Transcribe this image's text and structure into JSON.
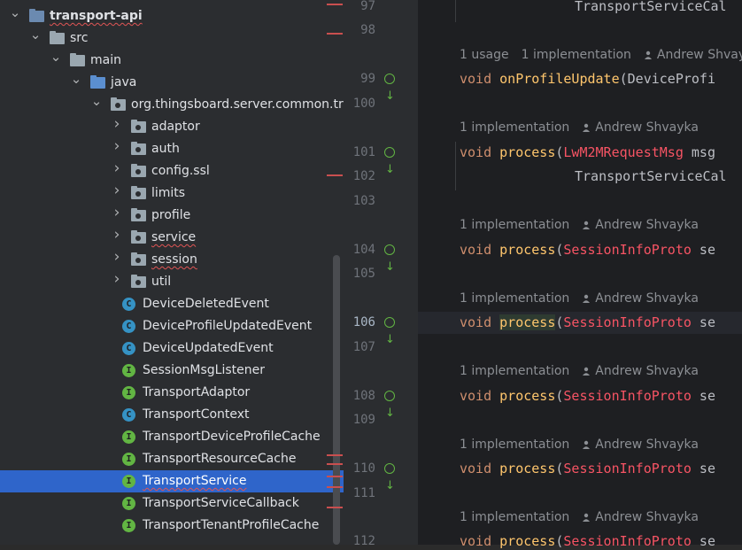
{
  "project_tree": {
    "items": [
      {
        "label": "transport-api",
        "icon": "module-folder-icon",
        "expand": "expanded",
        "squiggle": true,
        "bold": true
      },
      {
        "label": "src",
        "icon": "folder-icon",
        "expand": "expanded"
      },
      {
        "label": "main",
        "icon": "folder-icon",
        "expand": "expanded"
      },
      {
        "label": "java",
        "icon": "source-root-icon",
        "expand": "expanded"
      },
      {
        "label": "org.thingsboard.server.common.trans",
        "icon": "package-icon",
        "expand": "expanded"
      },
      {
        "label": "adaptor",
        "icon": "package-icon",
        "expand": "collapsed"
      },
      {
        "label": "auth",
        "icon": "package-icon",
        "expand": "collapsed"
      },
      {
        "label": "config.ssl",
        "icon": "package-icon",
        "expand": "collapsed"
      },
      {
        "label": "limits",
        "icon": "package-icon",
        "expand": "collapsed"
      },
      {
        "label": "profile",
        "icon": "package-icon",
        "expand": "collapsed"
      },
      {
        "label": "service",
        "icon": "package-icon",
        "expand": "collapsed",
        "squiggle": true
      },
      {
        "label": "session",
        "icon": "package-icon",
        "expand": "collapsed",
        "squiggle": true
      },
      {
        "label": "util",
        "icon": "package-icon",
        "expand": "collapsed"
      },
      {
        "label": "DeviceDeletedEvent",
        "icon": "class-icon",
        "kind": "C"
      },
      {
        "label": "DeviceProfileUpdatedEvent",
        "icon": "class-icon",
        "kind": "C"
      },
      {
        "label": "DeviceUpdatedEvent",
        "icon": "class-icon",
        "kind": "C"
      },
      {
        "label": "SessionMsgListener",
        "icon": "interface-icon",
        "kind": "I"
      },
      {
        "label": "TransportAdaptor",
        "icon": "interface-icon",
        "kind": "I"
      },
      {
        "label": "TransportContext",
        "icon": "class-icon",
        "kind": "C"
      },
      {
        "label": "TransportDeviceProfileCache",
        "icon": "interface-icon",
        "kind": "I"
      },
      {
        "label": "TransportResourceCache",
        "icon": "interface-icon",
        "kind": "I"
      },
      {
        "label": "TransportService",
        "icon": "interface-icon",
        "kind": "I",
        "selected": true,
        "squiggle": true
      },
      {
        "label": "TransportServiceCallback",
        "icon": "interface-icon",
        "kind": "I"
      },
      {
        "label": "TransportTenantProfileCache",
        "icon": "interface-icon",
        "kind": "I"
      }
    ]
  },
  "editor": {
    "current_line": "106",
    "line_numbers": [
      "97",
      "98",
      "99",
      "100",
      "101",
      "102",
      "103",
      "104",
      "105",
      "106",
      "107",
      "108",
      "109",
      "110",
      "111",
      "112"
    ],
    "hints": {
      "usage": "1 usage",
      "implementation": "1 implementation",
      "author": "Andrew Shvayka"
    },
    "code": {
      "l97": "TransportServiceCal",
      "l99_kw": "void",
      "l99_fn": "onProfileUpdate",
      "l99_rest": "(DeviceProfi",
      "l101_kw": "void",
      "l101_fn": "process",
      "l101_paren": "(",
      "l101_type": "LwM2MRequestMsg",
      "l101_rest": " msg",
      "l102": "TransportServiceCal",
      "proc_kw": "void",
      "proc_fn": "process",
      "proc_paren": "(",
      "proc_type": "SessionInfoProto",
      "proc_rest": " se"
    }
  },
  "colors": {
    "selection": "#2f65ca",
    "interface_icon": "#62b543",
    "class_icon": "#3592c4",
    "error": "#f75464",
    "keyword": "#cf8e6d",
    "function": "#56a8f5"
  }
}
